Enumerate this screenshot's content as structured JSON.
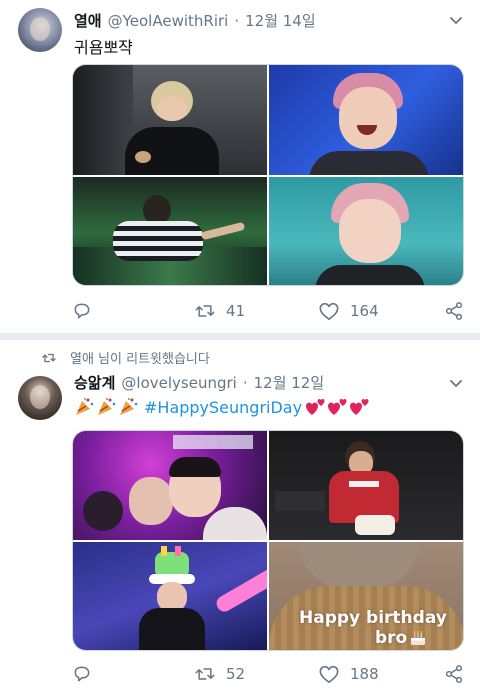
{
  "colors": {
    "link": "#1b95e0",
    "muted": "#657786",
    "text": "#14171a",
    "heart": "#e0245e"
  },
  "tweets": [
    {
      "name": "열애",
      "handle": "@YeolAewithRiri",
      "separator": "·",
      "date": "12월 14일",
      "text": "귀욤뽀쟉",
      "replies": "",
      "retweets": "41",
      "likes": "164"
    },
    {
      "retweet_notice": "열애 님이 리트윗했습니다",
      "name": "승앎계",
      "handle": "@lovelyseungri",
      "separator": "·",
      "date": "12월 12일",
      "hashtag": "#HappySeungriDay",
      "image_caption_line1": "Happy birthday",
      "image_caption_line2": "bro",
      "replies": "",
      "retweets": "52",
      "likes": "188"
    }
  ],
  "icons": [
    "reply-icon",
    "retweet-icon",
    "heart-icon",
    "share-icon",
    "chevron-down-icon",
    "party-popper-icon",
    "two-hearts-icon",
    "birthday-cake-icon"
  ]
}
